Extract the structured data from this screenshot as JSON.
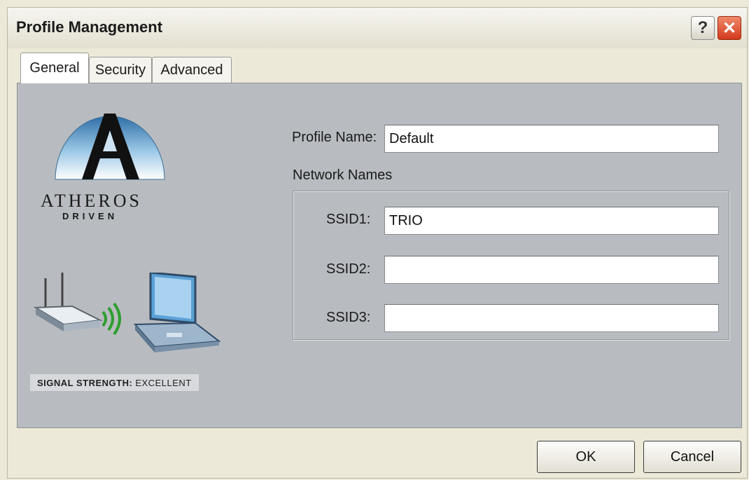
{
  "window": {
    "title": "Profile Management",
    "help_glyph": "?",
    "close_glyph": "✕"
  },
  "tabs": [
    {
      "label": "General",
      "active": true
    },
    {
      "label": "Security",
      "active": false
    },
    {
      "label": "Advanced",
      "active": false
    }
  ],
  "branding": {
    "logo_letter": "A",
    "name": "ATHEROS",
    "tagline": "DRIVEN"
  },
  "signal": {
    "label": "SIGNAL STRENGTH:",
    "value": "EXCELLENT"
  },
  "form": {
    "profile_name_label": "Profile Name:",
    "profile_name_value": "Default",
    "network_names_label": "Network Names",
    "ssid1_label": "SSID1:",
    "ssid1_value": "TRIO",
    "ssid2_label": "SSID2:",
    "ssid2_value": "",
    "ssid3_label": "SSID3:",
    "ssid3_value": ""
  },
  "buttons": {
    "ok": "OK",
    "cancel": "Cancel"
  },
  "colors": {
    "panel_bg": "#b8bcc0",
    "dialog_bg": "#ece9d8",
    "close_button": "#d4391b",
    "signal_waves": "#2e9e2e"
  }
}
